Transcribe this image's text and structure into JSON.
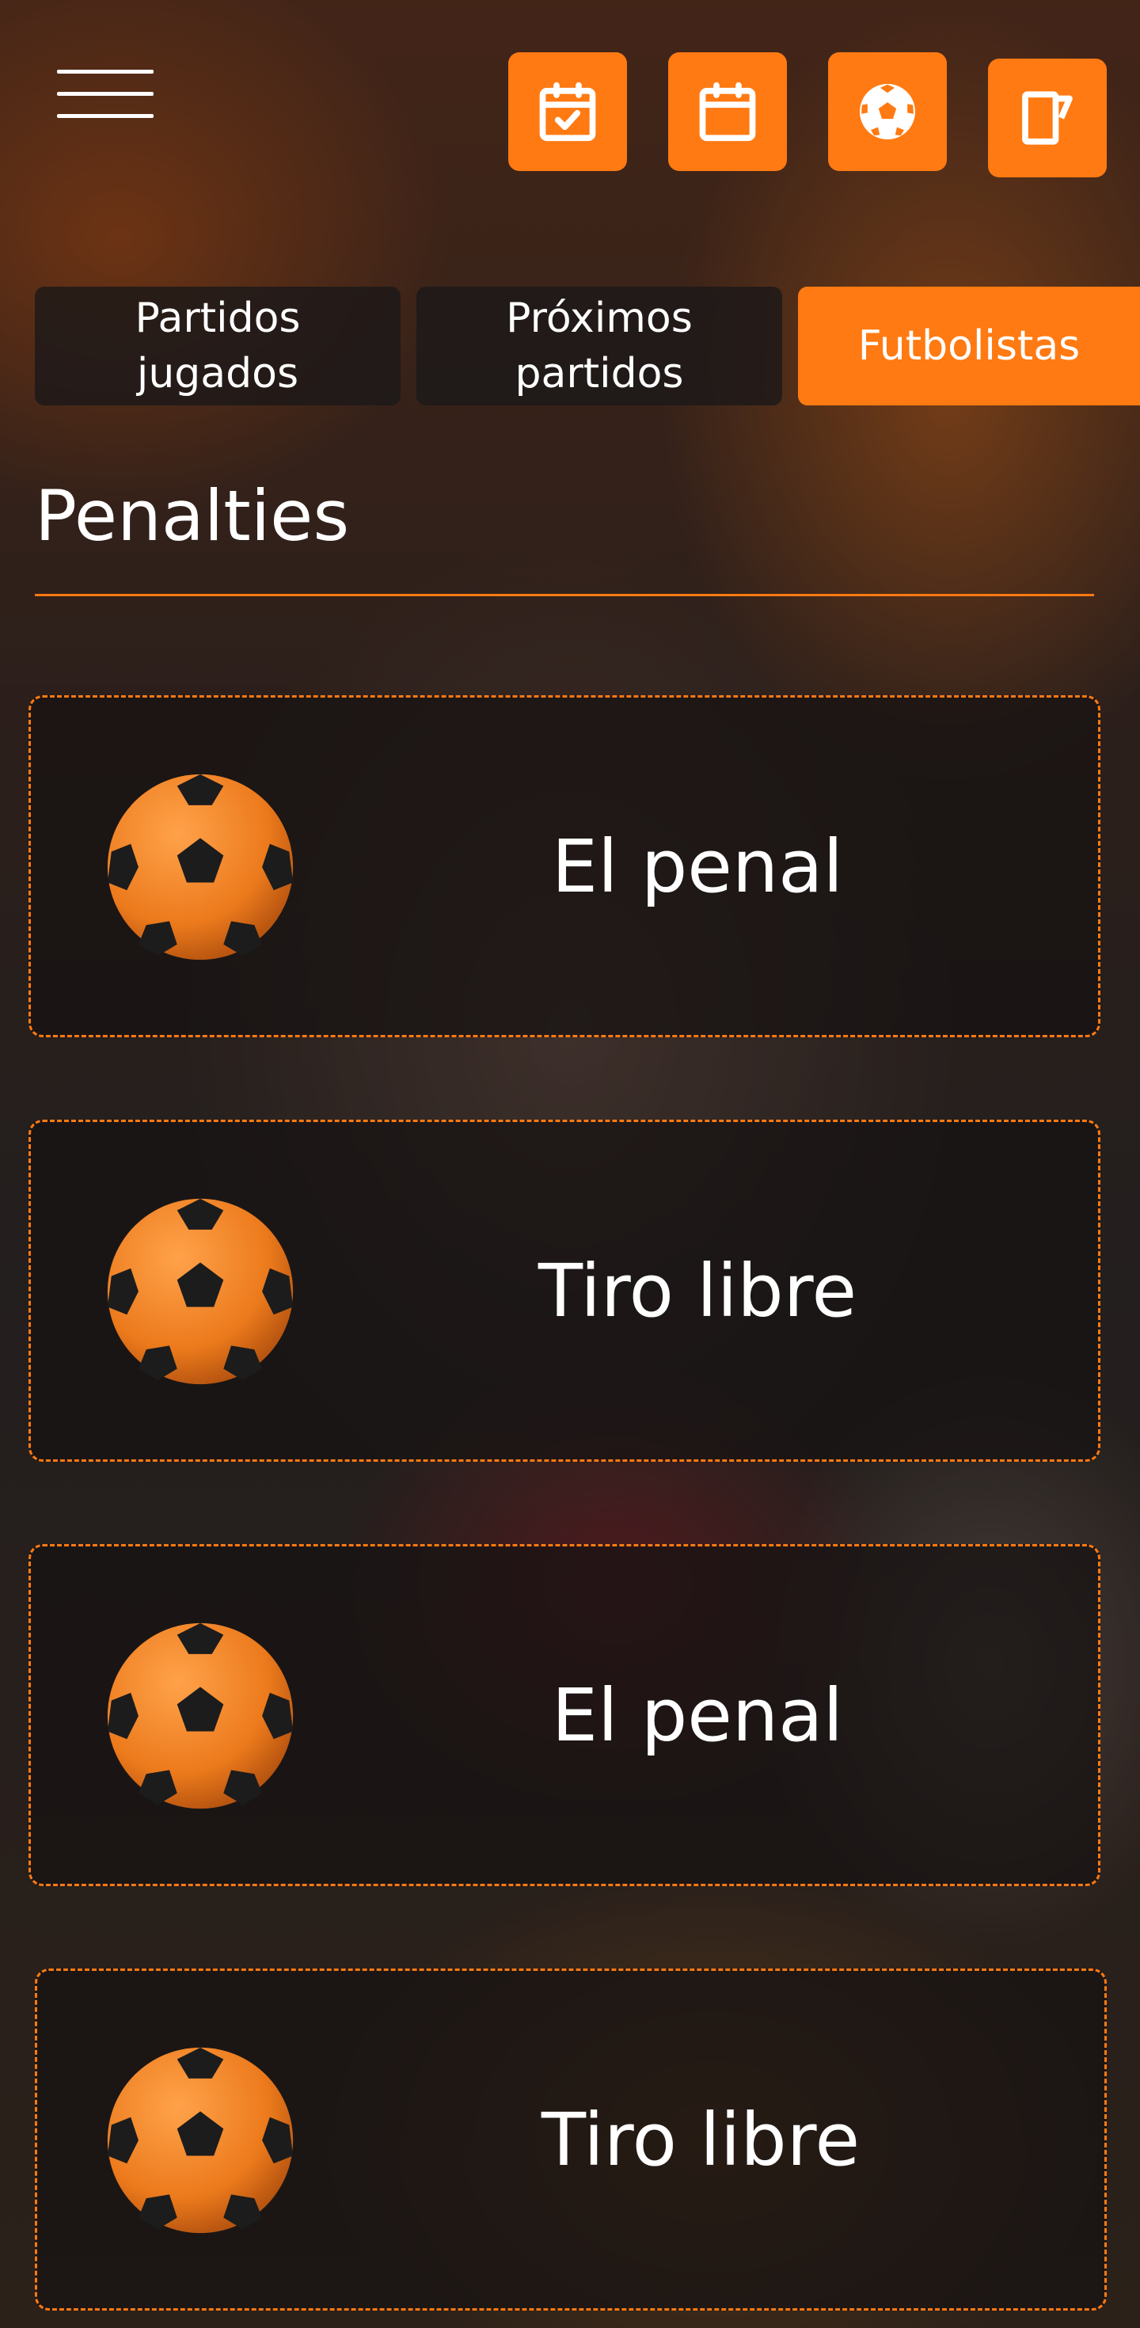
{
  "header": {
    "menu_icon": "hamburger-menu-icon",
    "buttons": [
      {
        "icon": "calendar-check-icon"
      },
      {
        "icon": "calendar-icon"
      },
      {
        "icon": "soccer-ball-icon"
      },
      {
        "icon": "card-edit-icon"
      }
    ]
  },
  "tabs": [
    {
      "label": "Partidos\njugados",
      "active": false
    },
    {
      "label": "Próximos\npartidos",
      "active": false
    },
    {
      "label": "Futbolistas",
      "active": true
    }
  ],
  "section": {
    "title": "Penalties"
  },
  "cards": [
    {
      "label": "El penal",
      "icon": "soccer-ball-icon"
    },
    {
      "label": "Tiro libre",
      "icon": "soccer-ball-icon"
    },
    {
      "label": "El penal",
      "icon": "soccer-ball-icon"
    },
    {
      "label": "Tiro libre",
      "icon": "soccer-ball-icon"
    }
  ],
  "colors": {
    "accent": "#ff7a12",
    "card_bg": "#1a1414",
    "text": "#ffffff"
  }
}
